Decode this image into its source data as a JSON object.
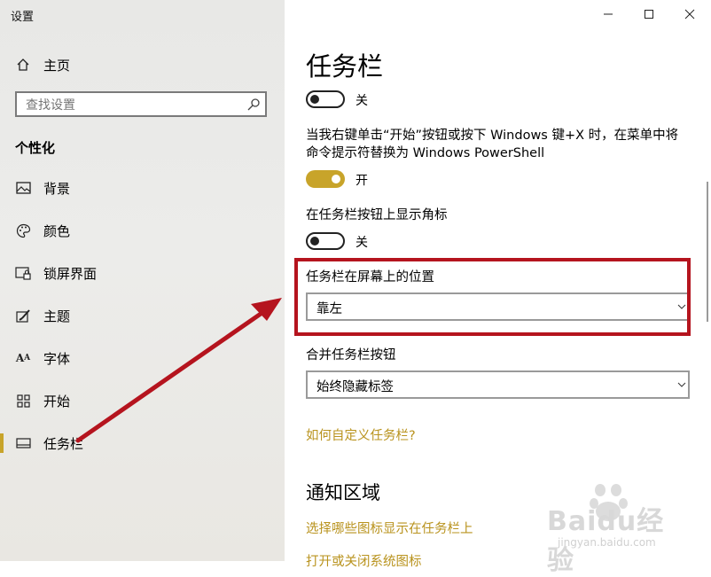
{
  "window": {
    "title": "设置"
  },
  "sidebar": {
    "home_label": "主页",
    "search_placeholder": "查找设置",
    "section": "个性化",
    "items": [
      {
        "label": "背景",
        "icon": "picture-icon"
      },
      {
        "label": "颜色",
        "icon": "palette-icon"
      },
      {
        "label": "锁屏界面",
        "icon": "lockscreen-icon"
      },
      {
        "label": "主题",
        "icon": "theme-brush-icon"
      },
      {
        "label": "字体",
        "icon": "font-icon"
      },
      {
        "label": "开始",
        "icon": "start-grid-icon"
      },
      {
        "label": "任务栏",
        "icon": "taskbar-icon",
        "active": true
      }
    ]
  },
  "content": {
    "title": "任务栏",
    "toggle1": {
      "state_label": "关",
      "on": false
    },
    "powershell_desc": "当我右键单击“开始”按钮或按下 Windows 键+X 时，在菜单中将命令提示符替换为 Windows PowerShell",
    "toggle2": {
      "state_label": "开",
      "on": true
    },
    "badges_label": "在任务栏按钮上显示角标",
    "toggle3": {
      "state_label": "关",
      "on": false
    },
    "position_label": "任务栏在屏幕上的位置",
    "position_value": "靠左",
    "combine_label": "合并任务栏按钮",
    "combine_value": "始终隐藏标签",
    "customize_link": "如何自定义任务栏?",
    "notification_heading": "通知区域",
    "select_icons_link": "选择哪些图标显示在任务栏上",
    "system_icons_link": "打开或关闭系统图标"
  },
  "watermark": {
    "brand": "Baidu经验",
    "url": "jingyan.baidu.com"
  },
  "colors": {
    "accent": "#c8a42a",
    "highlight_box": "#b5141e",
    "link": "#b9931e"
  }
}
